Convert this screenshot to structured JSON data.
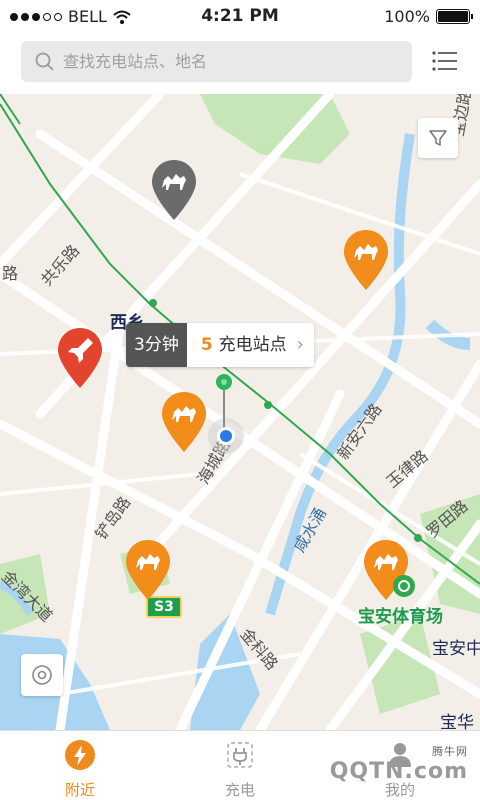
{
  "status_bar": {
    "carrier": "BELL",
    "time": "4:21 PM",
    "battery": "100%",
    "battery_level": 1.0
  },
  "search": {
    "placeholder": "查找充电站点、地名"
  },
  "map": {
    "place_labels": [
      {
        "text": "西乡"
      },
      {
        "text": "宝安体育场"
      },
      {
        "text": "宝安中"
      },
      {
        "text": "宝华"
      }
    ],
    "road_labels": [
      {
        "text": "共乐路"
      },
      {
        "text": "海城路"
      },
      {
        "text": "新安六路"
      },
      {
        "text": "玉律路"
      },
      {
        "text": "罗田路"
      },
      {
        "text": "铲岛路"
      },
      {
        "text": "金湾大道"
      },
      {
        "text": "金科路"
      },
      {
        "text": "咸水涌"
      },
      {
        "text": "路"
      },
      {
        "text": "宝边路"
      }
    ],
    "highway_shield": "S3",
    "tip": {
      "time": "3分钟",
      "count": "5",
      "count_label": "充电站点"
    },
    "colors": {
      "pin_orange": "#f28c1a",
      "pin_grey": "#6b6b6b",
      "pin_red": "#e2452e",
      "metro_line": "#2fa84f",
      "water": "#a9d4f2",
      "park": "#c7e6b8"
    }
  },
  "tabs": [
    {
      "label": "附近",
      "icon": "bolt-icon",
      "active": true
    },
    {
      "label": "充电",
      "icon": "plug-icon",
      "active": false
    },
    {
      "label": "我的",
      "icon": "person-icon",
      "active": false
    }
  ],
  "watermark": {
    "text": "QQTN.com",
    "sub": "腾牛网"
  }
}
